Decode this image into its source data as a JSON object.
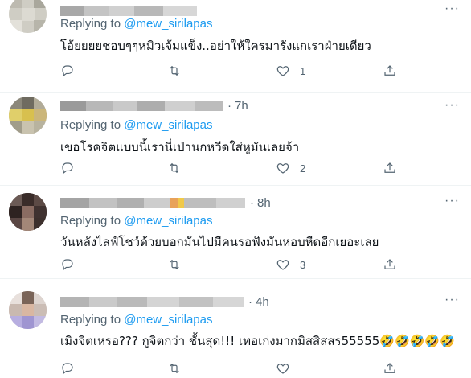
{
  "tweets": [
    {
      "time": "",
      "replying_prefix": "Replying to",
      "replying_handle": "@mew_sirilapas",
      "text": "โอ้ยยยยชอบๆๆหมิวเจ้มแข็ง..อย่าให้ใครมารังแกเราฝ่ายเดียว",
      "reply_count": "",
      "retweet_count": "",
      "like_count": "1"
    },
    {
      "time": "7h",
      "replying_prefix": "Replying to",
      "replying_handle": "@mew_sirilapas",
      "text": "เขอโรคจิตแบบนี้เรานี่เป่านกหวีดใส่หูมันเลยจ้า",
      "reply_count": "",
      "retweet_count": "",
      "like_count": "2"
    },
    {
      "time": "8h",
      "replying_prefix": "Replying to",
      "replying_handle": "@mew_sirilapas",
      "text": "วันหลังไลฟ์โชว์ด้วยบอกมันไปมีคนรอฟังมันหอบหืดอีกเยอะเลย",
      "reply_count": "",
      "retweet_count": "",
      "like_count": "3"
    },
    {
      "time": "4h",
      "replying_prefix": "Replying to",
      "replying_handle": "@mew_sirilapas",
      "text": "เมิงจิตเหรอ??? กูจิตกว่า ชั้นสุด!!! เทอเก่งมากมิสสิสสร55555🤣🤣🤣🤣🤣",
      "reply_count": "",
      "retweet_count": "",
      "like_count": ""
    }
  ],
  "header": {
    "separator": "·"
  },
  "icons": {
    "reply": "reply-icon",
    "retweet": "retweet-icon",
    "like": "heart-icon",
    "share": "share-icon",
    "more": "more-icon"
  },
  "colors": {
    "link": "#1d9bf0",
    "muted": "#536471",
    "text": "#0f1419",
    "divider": "#eff3f4"
  }
}
